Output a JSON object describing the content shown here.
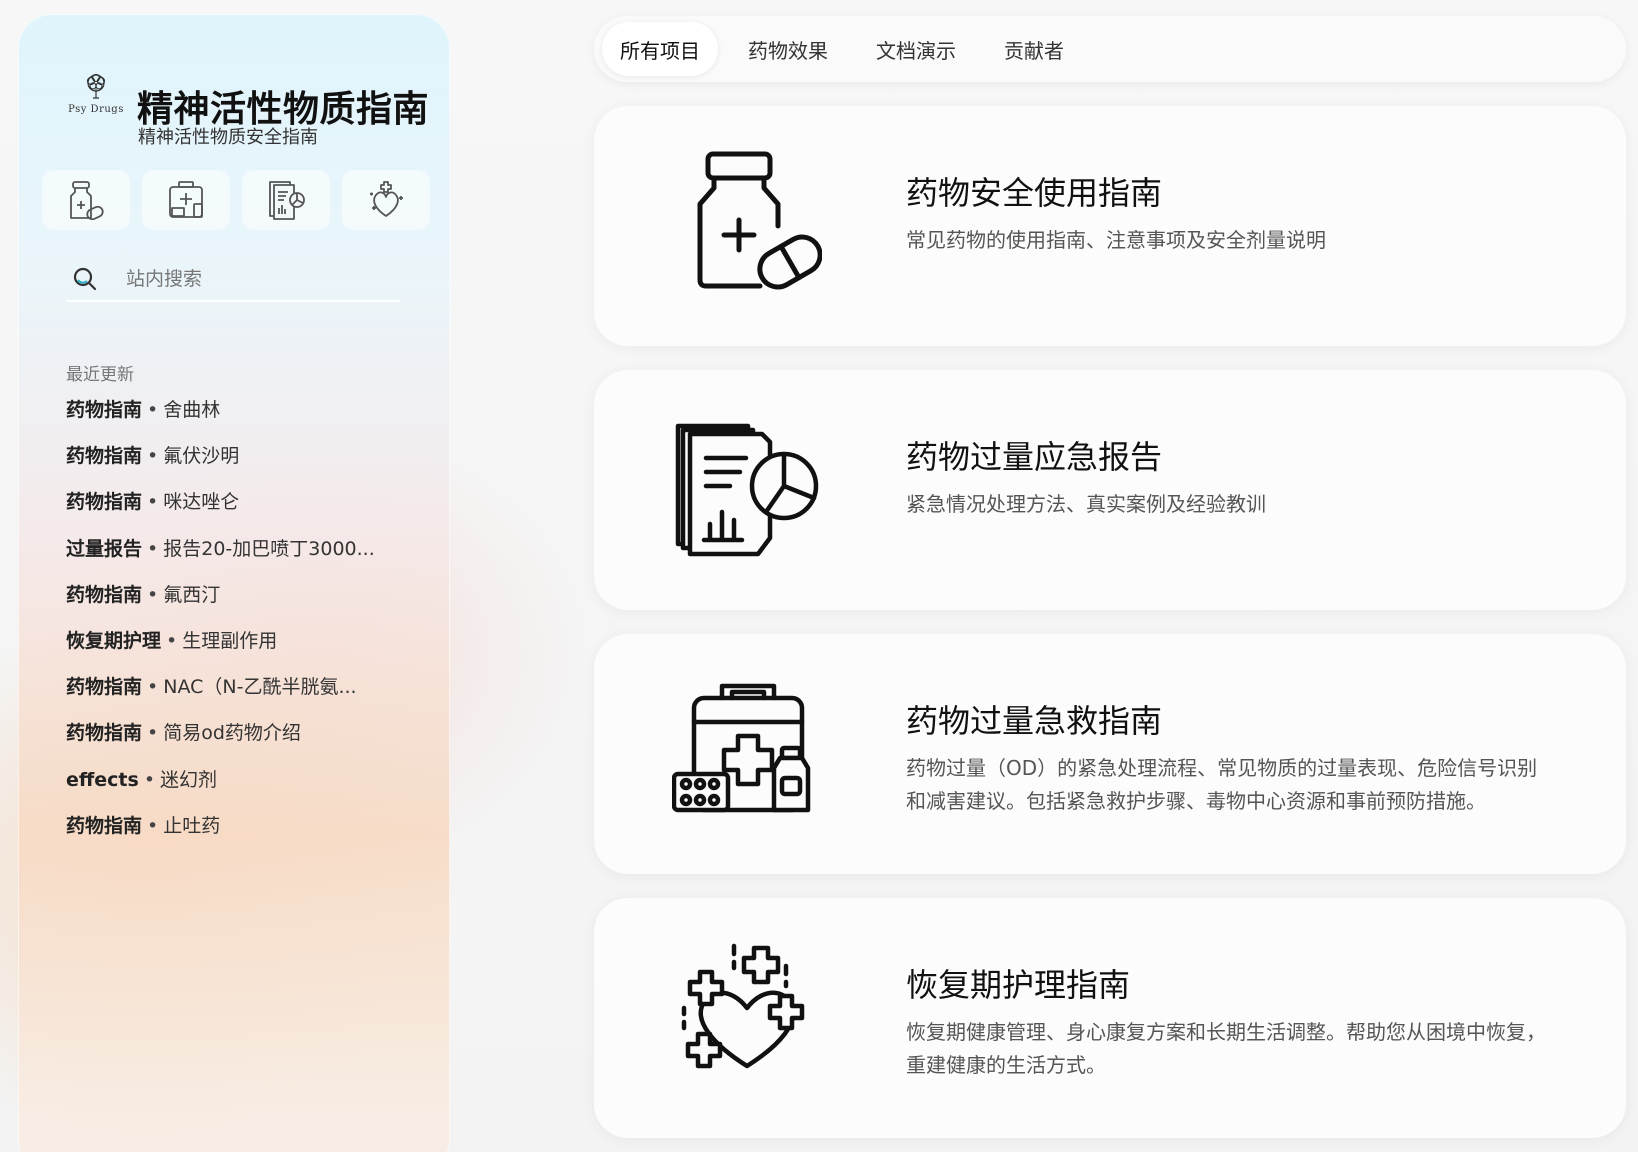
{
  "site": {
    "logo_text": "Psy Drugs",
    "title": "精神活性物质指南",
    "subtitle": "精神活性物质安全指南"
  },
  "quick_links": [
    {
      "icon": "pill-bottle-icon"
    },
    {
      "icon": "first-aid-kit-icon"
    },
    {
      "icon": "report-document-icon"
    },
    {
      "icon": "heart-care-icon"
    }
  ],
  "search": {
    "placeholder": "站内搜索"
  },
  "recent": {
    "title": "最近更新",
    "items": [
      {
        "category": "药物指南",
        "title": "舍曲林"
      },
      {
        "category": "药物指南",
        "title": "氟伏沙明"
      },
      {
        "category": "药物指南",
        "title": "咪达唑仑"
      },
      {
        "category": "过量报告",
        "title": "报告20-加巴喷丁3000..."
      },
      {
        "category": "药物指南",
        "title": "氟西汀"
      },
      {
        "category": "恢复期护理",
        "title": "生理副作用"
      },
      {
        "category": "药物指南",
        "title": "NAC（N-乙酰半胱氨..."
      },
      {
        "category": "药物指南",
        "title": "简易od药物介绍"
      },
      {
        "category": "effects",
        "title": "迷幻剂"
      },
      {
        "category": "药物指南",
        "title": "止吐药"
      }
    ]
  },
  "tabs": [
    {
      "label": "所有项目",
      "active": true
    },
    {
      "label": "药物效果",
      "active": false
    },
    {
      "label": "文档演示",
      "active": false
    },
    {
      "label": "贡献者",
      "active": false
    }
  ],
  "cards": [
    {
      "icon": "medicine-bottle-icon",
      "title": "药物安全使用指南",
      "desc": "常见药物的使用指南、注意事项及安全剂量说明"
    },
    {
      "icon": "report-chart-icon",
      "title": "药物过量应急报告",
      "desc": "紧急情况处理方法、真实案例及经验教训"
    },
    {
      "icon": "first-aid-kit-icon",
      "title": "药物过量急救指南",
      "desc": "药物过量（OD）的紧急处理流程、常见物质的过量表现、危险信号识别和减害建议。包括紧急救护步骤、毒物中心资源和事前预防措施。"
    },
    {
      "icon": "heart-care-icon",
      "title": "恢复期护理指南",
      "desc": "恢复期健康管理、身心康复方案和长期生活调整。帮助您从困境中恢复，重建健康的生活方式。"
    }
  ]
}
